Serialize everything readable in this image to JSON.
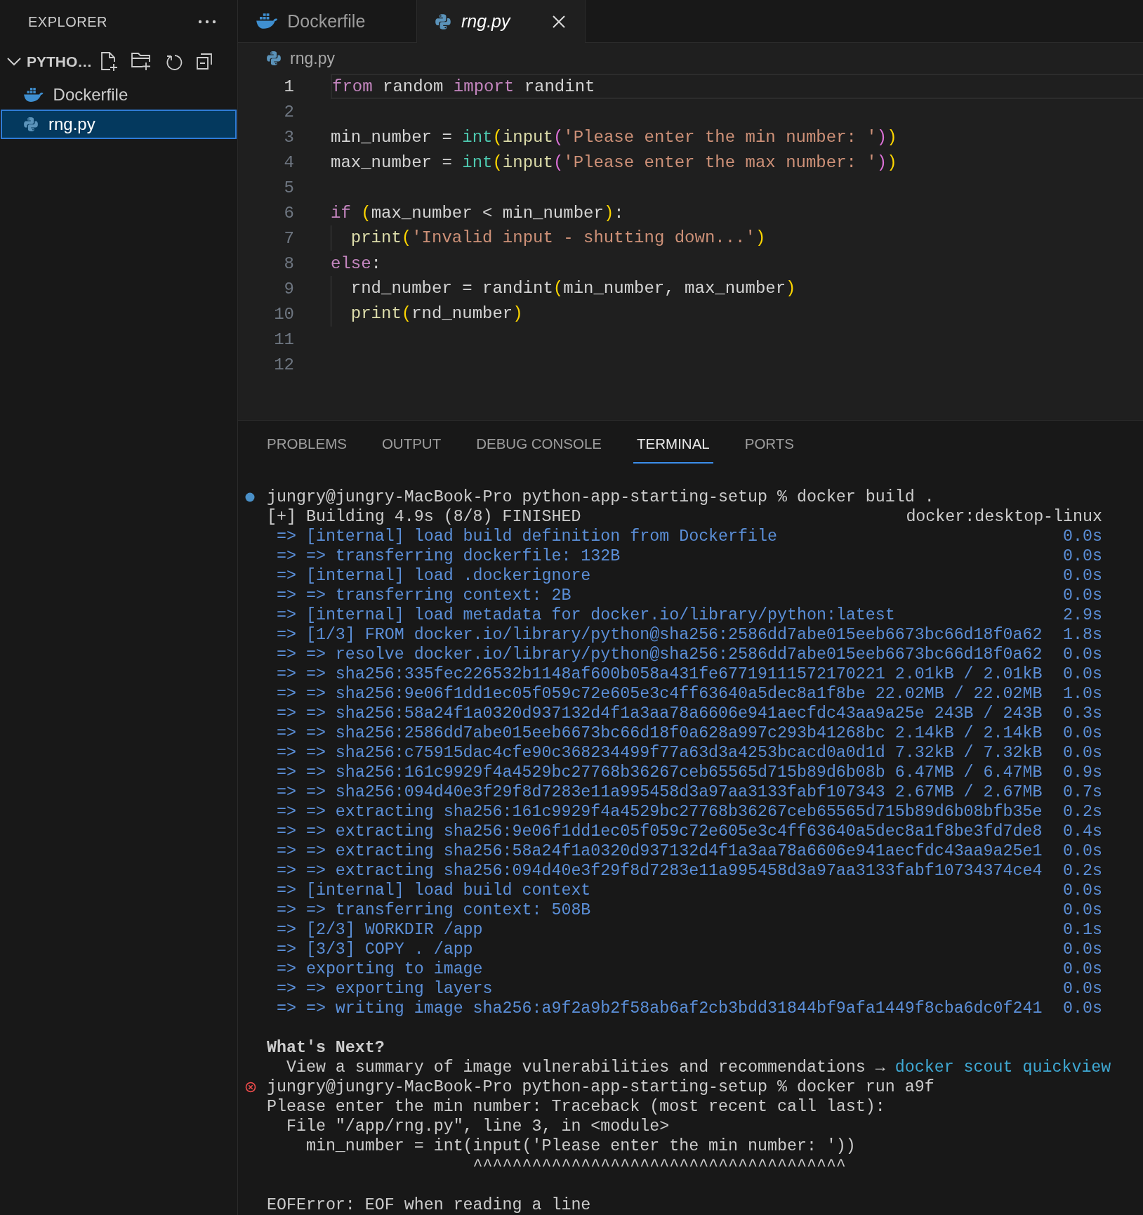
{
  "sidebar": {
    "title": "EXPLORER",
    "folder": {
      "name": "PYTHO…",
      "expanded": true
    },
    "files": [
      {
        "name": "Dockerfile",
        "kind": "docker",
        "selected": false
      },
      {
        "name": "rng.py",
        "kind": "python",
        "selected": true
      }
    ]
  },
  "tabs": [
    {
      "label": "Dockerfile",
      "kind": "docker",
      "selected": false,
      "preview": false
    },
    {
      "label": "rng.py",
      "kind": "python",
      "selected": true,
      "preview": true
    }
  ],
  "breadcrumb": {
    "label": "rng.py",
    "kind": "python"
  },
  "editor": {
    "lines": [
      {
        "number": "1",
        "current": true,
        "tokens": [
          {
            "kind": "kw",
            "text": "from"
          },
          {
            "kind": "id",
            "text": " random "
          },
          {
            "kind": "kw",
            "text": "import"
          },
          {
            "kind": "id",
            "text": " randint"
          }
        ]
      },
      {
        "number": "2",
        "current": false
      },
      {
        "number": "3",
        "current": false,
        "tokens": [
          {
            "kind": "id",
            "text": "min_number = "
          },
          {
            "kind": "bi",
            "text": "int"
          },
          {
            "kind": "p1",
            "text": "("
          },
          {
            "kind": "fn",
            "text": "input"
          },
          {
            "kind": "p2",
            "text": "("
          },
          {
            "kind": "str",
            "text": "'Please enter the min number: '"
          },
          {
            "kind": "p2",
            "text": ")"
          },
          {
            "kind": "p1",
            "text": ")"
          }
        ]
      },
      {
        "number": "4",
        "current": false,
        "tokens": [
          {
            "kind": "id",
            "text": "max_number = "
          },
          {
            "kind": "bi",
            "text": "int"
          },
          {
            "kind": "p1",
            "text": "("
          },
          {
            "kind": "fn",
            "text": "input"
          },
          {
            "kind": "p2",
            "text": "("
          },
          {
            "kind": "str",
            "text": "'Please enter the max number: '"
          },
          {
            "kind": "p2",
            "text": ")"
          },
          {
            "kind": "p1",
            "text": ")"
          }
        ]
      },
      {
        "number": "5",
        "current": false
      },
      {
        "number": "6",
        "current": false,
        "tokens": [
          {
            "kind": "kw",
            "text": "if "
          },
          {
            "kind": "p1",
            "text": "("
          },
          {
            "kind": "id",
            "text": "max_number < min_number"
          },
          {
            "kind": "p1",
            "text": ")"
          },
          {
            "kind": "id",
            "text": ":"
          }
        ]
      },
      {
        "number": "7",
        "current": false,
        "indented": true,
        "tokens": [
          {
            "kind": "fn",
            "text": "print"
          },
          {
            "kind": "p1",
            "text": "("
          },
          {
            "kind": "str",
            "text": "'Invalid input - shutting down...'"
          },
          {
            "kind": "p1",
            "text": ")"
          }
        ]
      },
      {
        "number": "8",
        "current": false,
        "tokens": [
          {
            "kind": "kw",
            "text": "else"
          },
          {
            "kind": "id",
            "text": ":"
          }
        ]
      },
      {
        "number": "9",
        "current": false,
        "indented": true,
        "tokens": [
          {
            "kind": "id",
            "text": "rnd_number = randint"
          },
          {
            "kind": "p1",
            "text": "("
          },
          {
            "kind": "id",
            "text": "min_number, max_number"
          },
          {
            "kind": "p1",
            "text": ")"
          }
        ]
      },
      {
        "number": "10",
        "current": false,
        "indented": true,
        "tokens": [
          {
            "kind": "fn",
            "text": "print"
          },
          {
            "kind": "p1",
            "text": "("
          },
          {
            "kind": "id",
            "text": "rnd_number"
          },
          {
            "kind": "p1",
            "text": ")"
          }
        ]
      },
      {
        "number": "11",
        "current": false
      },
      {
        "number": "12",
        "current": false
      }
    ]
  },
  "panel": {
    "tabs": [
      {
        "label": "PROBLEMS",
        "selected": false
      },
      {
        "label": "OUTPUT",
        "selected": false
      },
      {
        "label": "DEBUG CONSOLE",
        "selected": false
      },
      {
        "label": "TERMINAL",
        "selected": true
      },
      {
        "label": "PORTS",
        "selected": false
      }
    ],
    "terminal": [
      {
        "kind": "prompt",
        "text": "jungry@jungry-MacBook-Pro python-app-starting-setup % docker build ."
      },
      {
        "kind": "build",
        "text": "[+] Building 4.9s (8/8) FINISHED",
        "right": "docker:desktop-linux"
      },
      {
        "kind": "step",
        "text": " => [internal] load build definition from Dockerfile",
        "time": "0.0s"
      },
      {
        "kind": "step",
        "text": " => => transferring dockerfile: 132B",
        "time": "0.0s"
      },
      {
        "kind": "step",
        "text": " => [internal] load .dockerignore",
        "time": "0.0s"
      },
      {
        "kind": "step",
        "text": " => => transferring context: 2B",
        "time": "0.0s"
      },
      {
        "kind": "step",
        "text": " => [internal] load metadata for docker.io/library/python:latest",
        "time": "2.9s"
      },
      {
        "kind": "step",
        "text": " => [1/3] FROM docker.io/library/python@sha256:2586dd7abe015eeb6673bc66d18f0a62",
        "time": "1.8s"
      },
      {
        "kind": "step",
        "text": " => => resolve docker.io/library/python@sha256:2586dd7abe015eeb6673bc66d18f0a62",
        "time": "0.0s"
      },
      {
        "kind": "step",
        "text": " => => sha256:335fec226532b1148af600b058a431fe67719111572170221 2.01kB / 2.01kB",
        "time": "0.0s"
      },
      {
        "kind": "step",
        "text": " => => sha256:9e06f1dd1ec05f059c72e605e3c4ff63640a5dec8a1f8be 22.02MB / 22.02MB",
        "time": "1.0s"
      },
      {
        "kind": "step",
        "text": " => => sha256:58a24f1a0320d937132d4f1a3aa78a6606e941aecfdc43aa9a25e 243B / 243B",
        "time": "0.3s"
      },
      {
        "kind": "step",
        "text": " => => sha256:2586dd7abe015eeb6673bc66d18f0a628a997c293b41268bc 2.14kB / 2.14kB",
        "time": "0.0s"
      },
      {
        "kind": "step",
        "text": " => => sha256:c75915dac4cfe90c368234499f77a63d3a4253bcacd0a0d1d 7.32kB / 7.32kB",
        "time": "0.0s"
      },
      {
        "kind": "step",
        "text": " => => sha256:161c9929f4a4529bc27768b36267ceb65565d715b89d6b08b 6.47MB / 6.47MB",
        "time": "0.9s"
      },
      {
        "kind": "step",
        "text": " => => sha256:094d40e3f29f8d7283e11a995458d3a97aa3133fabf107343 2.67MB / 2.67MB",
        "time": "0.7s"
      },
      {
        "kind": "step",
        "text": " => => extracting sha256:161c9929f4a4529bc27768b36267ceb65565d715b89d6b08bfb35e",
        "time": "0.2s"
      },
      {
        "kind": "step",
        "text": " => => extracting sha256:9e06f1dd1ec05f059c72e605e3c4ff63640a5dec8a1f8be3fd7de8",
        "time": "0.4s"
      },
      {
        "kind": "step",
        "text": " => => extracting sha256:58a24f1a0320d937132d4f1a3aa78a6606e941aecfdc43aa9a25e1",
        "time": "0.0s"
      },
      {
        "kind": "step",
        "text": " => => extracting sha256:094d40e3f29f8d7283e11a995458d3a97aa3133fabf10734374ce4",
        "time": "0.2s"
      },
      {
        "kind": "step",
        "text": " => [internal] load build context",
        "time": "0.0s"
      },
      {
        "kind": "step",
        "text": " => => transferring context: 508B",
        "time": "0.0s"
      },
      {
        "kind": "step",
        "text": " => [2/3] WORKDIR /app",
        "time": "0.1s"
      },
      {
        "kind": "step",
        "text": " => [3/3] COPY . /app",
        "time": "0.0s"
      },
      {
        "kind": "step",
        "text": " => exporting to image",
        "time": "0.0s"
      },
      {
        "kind": "step",
        "text": " => => exporting layers",
        "time": "0.0s"
      },
      {
        "kind": "step",
        "text": " => => writing image sha256:a9f2a9b2f58ab6af2cb3bdd31844bf9afa1449f8cba6dc0f241",
        "time": "0.0s"
      },
      {
        "kind": "blank"
      },
      {
        "kind": "heading",
        "text": "What's Next?"
      },
      {
        "kind": "hint",
        "text": "  View a summary of image vulnerabilities and recommendations →",
        "link": "docker scout quickview"
      },
      {
        "kind": "errorprompt",
        "text": "jungry@jungry-MacBook-Pro python-app-starting-setup % docker run a9f"
      },
      {
        "kind": "output",
        "text": "Please enter the min number: Traceback (most recent call last):"
      },
      {
        "kind": "output",
        "text": "  File \"/app/rng.py\", line 3, in <module>"
      },
      {
        "kind": "output",
        "text": "    min_number = int(input('Please enter the min number: '))"
      },
      {
        "kind": "output",
        "text": "                     ^^^^^^^^^^^^^^^^^^^^^^^^^^^^^^^^^^^^^^"
      },
      {
        "kind": "blank"
      },
      {
        "kind": "output",
        "text": "EOFError: EOF when reading a line"
      }
    ]
  }
}
